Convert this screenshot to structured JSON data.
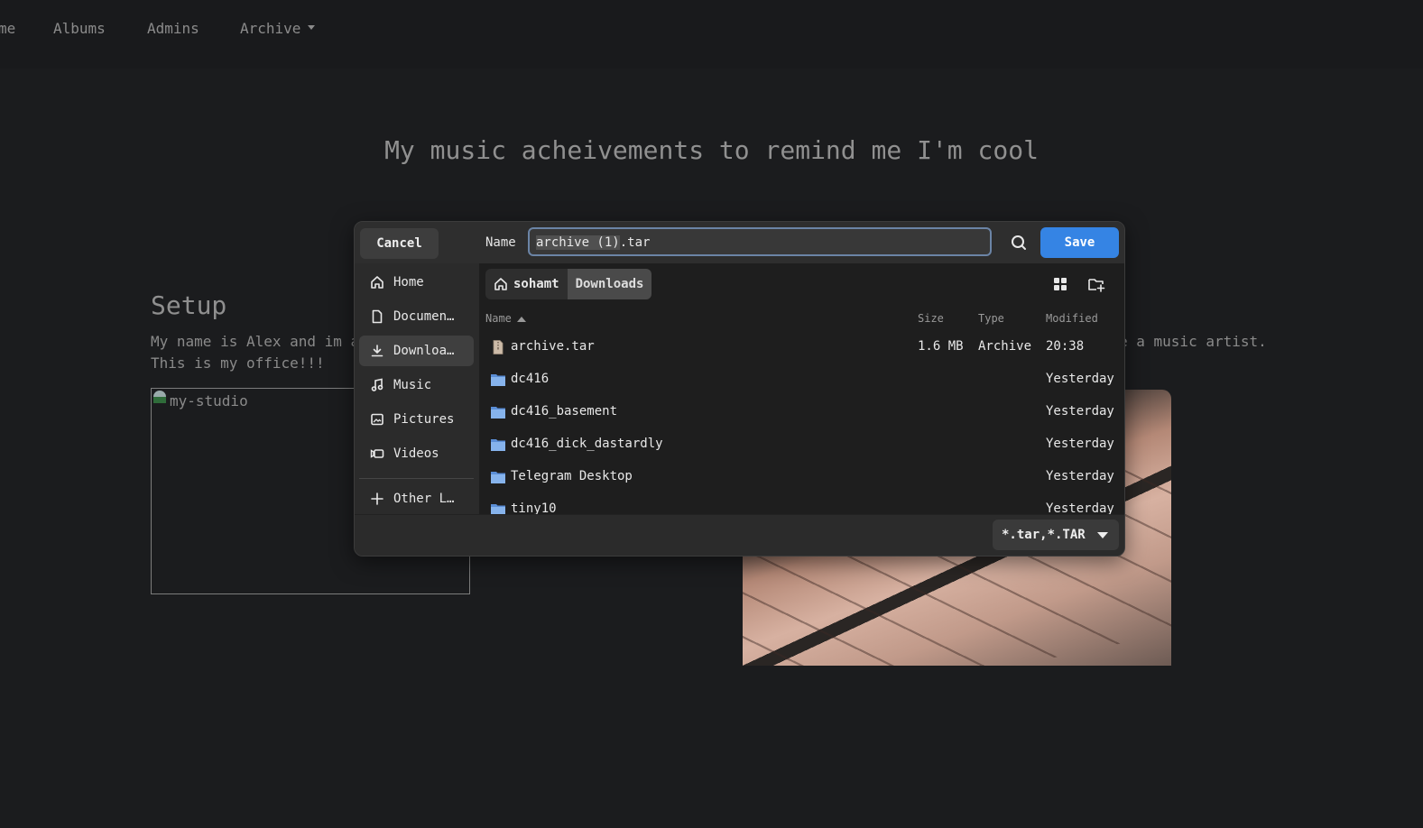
{
  "nav": {
    "items": [
      {
        "label": "me"
      },
      {
        "label": "Albums"
      },
      {
        "label": "Admins"
      },
      {
        "label": "Archive"
      }
    ]
  },
  "page": {
    "title": "My music acheivements to remind me I'm cool",
    "setup_heading": "Setup",
    "para_line1": "My name is Alex and im a",
    "para_line2": "This is my office!!!",
    "para_right": "e a music artist.",
    "image_alt": "my-studio"
  },
  "dialog": {
    "cancel_label": "Cancel",
    "name_label": "Name",
    "name_value_selected": "archive (1)",
    "name_value_ext": ".tar",
    "save_label": "Save",
    "sidebar": [
      {
        "label": "Home",
        "icon": "home-icon"
      },
      {
        "label": "Documen…",
        "icon": "document-icon"
      },
      {
        "label": "Downloa…",
        "icon": "download-icon",
        "active": true
      },
      {
        "label": "Music",
        "icon": "music-icon"
      },
      {
        "label": "Pictures",
        "icon": "picture-icon"
      },
      {
        "label": "Videos",
        "icon": "video-icon"
      },
      {
        "label": "Other L…",
        "icon": "plus-icon"
      }
    ],
    "breadcrumb": [
      "sohamt",
      "Downloads"
    ],
    "columns": {
      "name": "Name",
      "size": "Size",
      "type": "Type",
      "modified": "Modified"
    },
    "files": [
      {
        "name": "archive.tar",
        "size": "1.6 MB",
        "type": "Archive",
        "modified": "20:38",
        "icon": "archive-file-icon"
      },
      {
        "name": "dc416",
        "size": "",
        "type": "",
        "modified": "Yesterday",
        "icon": "folder-icon"
      },
      {
        "name": "dc416_basement",
        "size": "",
        "type": "",
        "modified": "Yesterday",
        "icon": "folder-icon"
      },
      {
        "name": "dc416_dick_dastardly",
        "size": "",
        "type": "",
        "modified": "Yesterday",
        "icon": "folder-icon"
      },
      {
        "name": "Telegram Desktop",
        "size": "",
        "type": "",
        "modified": "Yesterday",
        "icon": "folder-icon"
      },
      {
        "name": "tiny10",
        "size": "",
        "type": "",
        "modified": "Yesterday",
        "icon": "folder-icon"
      }
    ],
    "filter_label": "*.tar,*.TAR"
  },
  "colors": {
    "accent": "#3584e4",
    "folder": "#76a8e6",
    "page_bg": "#1b1c1e"
  }
}
